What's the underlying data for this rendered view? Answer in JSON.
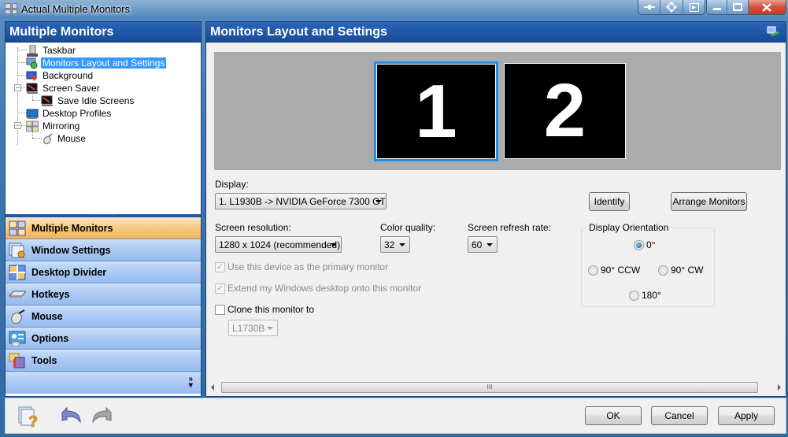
{
  "window": {
    "title": "Actual Multiple Monitors",
    "caption_buttons": [
      "pin-icon",
      "move-icon",
      "send-to-monitor-icon",
      "minimize-icon",
      "maximize-icon",
      "close-icon"
    ]
  },
  "left_pane": {
    "header": "Multiple Monitors",
    "tree": [
      {
        "label": "Taskbar",
        "icon": "taskbar-icon",
        "level": 0,
        "selected": false
      },
      {
        "label": "Monitors Layout and Settings",
        "icon": "monitors-layout-icon",
        "level": 0,
        "selected": true
      },
      {
        "label": "Background",
        "icon": "background-icon",
        "level": 0,
        "selected": false
      },
      {
        "label": "Screen Saver",
        "icon": "screen-saver-icon",
        "level": 0,
        "selected": false,
        "expanded": true
      },
      {
        "label": "Save Idle Screens",
        "icon": "save-idle-screens-icon",
        "level": 1,
        "selected": false
      },
      {
        "label": "Desktop Profiles",
        "icon": "desktop-profiles-icon",
        "level": 0,
        "selected": false
      },
      {
        "label": "Mirroring",
        "icon": "mirroring-icon",
        "level": 0,
        "selected": false,
        "expanded": true
      },
      {
        "label": "Mouse",
        "icon": "mouse-icon",
        "level": 1,
        "selected": false
      }
    ],
    "nav": [
      {
        "label": "Multiple Monitors",
        "icon": "multiple-monitors-icon",
        "active": true
      },
      {
        "label": "Window Settings",
        "icon": "window-settings-icon",
        "active": false
      },
      {
        "label": "Desktop Divider",
        "icon": "desktop-divider-icon",
        "active": false
      },
      {
        "label": "Hotkeys",
        "icon": "keyboard-icon",
        "active": false
      },
      {
        "label": "Mouse",
        "icon": "mouse-icon",
        "active": false
      },
      {
        "label": "Options",
        "icon": "options-icon",
        "active": false
      },
      {
        "label": "Tools",
        "icon": "tools-icon",
        "active": false
      }
    ],
    "more_icon": "chevron-double-down-icon"
  },
  "right_pane": {
    "header": "Monitors Layout and Settings",
    "monitors": [
      {
        "number": "1",
        "selected": true
      },
      {
        "number": "2",
        "selected": false
      }
    ],
    "display_label": "Display:",
    "display_value": "1. L1930B -> NVIDIA GeForce 7300 GT",
    "identify_label": "Identify",
    "arrange_label": "Arrange Monitors",
    "resolution_label": "Screen resolution:",
    "resolution_value": "1280 x 1024 (recommended)",
    "color_label": "Color quality:",
    "color_value": "32",
    "refresh_label": "Screen refresh rate:",
    "refresh_value": "60",
    "primary_label": "Use this device as the primary monitor",
    "primary_checked": true,
    "extend_label": "Extend my Windows desktop onto this monitor",
    "extend_checked": true,
    "clone_label": "Clone this monitor to",
    "clone_checked": false,
    "clone_target": "L1730B",
    "orientation": {
      "title": "Display Orientation",
      "options": [
        "0°",
        "90° CCW",
        "90° CW",
        "180°"
      ],
      "selected": "0°"
    },
    "scroll_grip": "III"
  },
  "bottom": {
    "ok_label": "OK",
    "cancel_label": "Cancel",
    "apply_label": "Apply",
    "check_mark": "✓"
  }
}
